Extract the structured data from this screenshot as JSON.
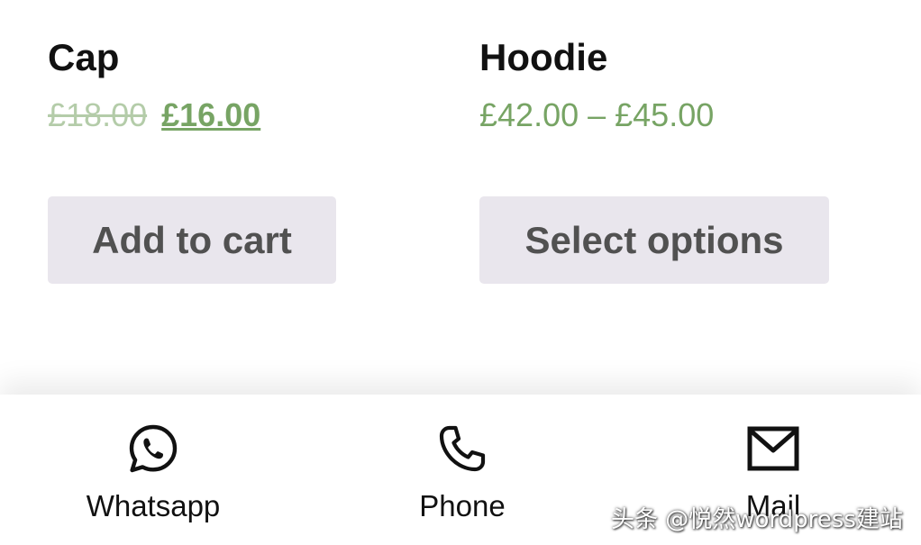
{
  "products": [
    {
      "title": "Cap",
      "price_old": "£18.00",
      "price_new": "£16.00",
      "button_label": "Add to cart"
    },
    {
      "title": "Hoodie",
      "price_range": "£42.00 – £45.00",
      "button_label": "Select options"
    }
  ],
  "bottom_nav": {
    "items": [
      {
        "label": "Whatsapp",
        "icon": "whatsapp-icon"
      },
      {
        "label": "Phone",
        "icon": "phone-icon"
      },
      {
        "label": "Mail",
        "icon": "mail-icon"
      }
    ]
  },
  "watermark": "头条 @悦然wordpress建站",
  "colors": {
    "price_green": "#77a464",
    "button_bg": "#e9e6ed",
    "button_text": "#515151",
    "title_text": "#111111"
  }
}
